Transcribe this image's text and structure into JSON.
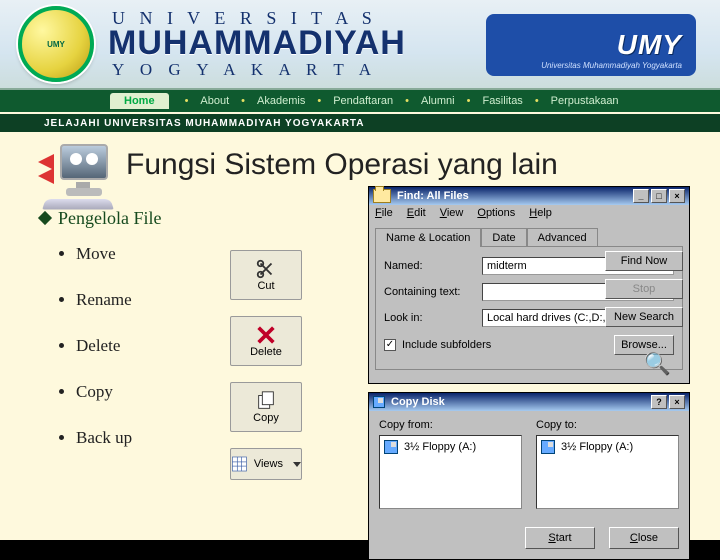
{
  "header": {
    "uni_top": "U N I V E R S I T A S",
    "uni_main": "MUHAMMADIYAH",
    "uni_sub": "Y O G Y A K A R T A",
    "umy_big": "UMY",
    "umy_small": "Universitas Muhammadiyah Yogyakarta",
    "logo_text": "UMY"
  },
  "nav": {
    "home": "Home",
    "items": [
      "About",
      "Akademis",
      "Pendaftaran",
      "Alumni",
      "Fasilitas",
      "Perpustakaan"
    ]
  },
  "marquee": "JELAJAHI UNIVERSITAS MUHAMMADIYAH YOGYAKARTA",
  "title": "Fungsi Sistem Operasi yang lain",
  "section": "Pengelola File",
  "bullets": [
    "Move",
    "Rename",
    "Delete",
    "Copy",
    "Back up"
  ],
  "tools": {
    "cut": "Cut",
    "delete": "Delete",
    "copy": "Copy",
    "views": "Views"
  },
  "find": {
    "title": "Find: All Files",
    "menu": [
      "File",
      "Edit",
      "View",
      "Options",
      "Help"
    ],
    "tabs": [
      "Name & Location",
      "Date",
      "Advanced"
    ],
    "labels": {
      "named": "Named:",
      "containing": "Containing text:",
      "lookin": "Look in:"
    },
    "named_value": "midterm",
    "containing_value": "",
    "lookin_value": "Local hard drives (C:,D:,E:)",
    "include_sub": "Include subfolders",
    "buttons": {
      "findnow": "Find Now",
      "stop": "Stop",
      "newsearch": "New Search",
      "browse": "Browse..."
    }
  },
  "copydisk": {
    "title": "Copy Disk",
    "from": "Copy from:",
    "to": "Copy to:",
    "item": "3½ Floppy (A:)",
    "start": "Start",
    "close": "Close"
  }
}
